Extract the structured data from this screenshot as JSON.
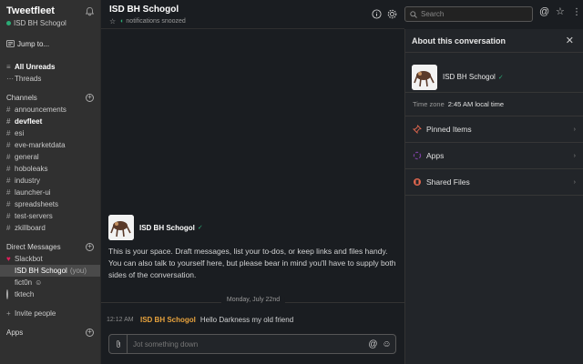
{
  "workspace": {
    "name": "Tweetfleet",
    "user": "ISD BH Schogol"
  },
  "sidebar": {
    "jump_label": "Jump to...",
    "all_unreads": "All Unreads",
    "threads": "Threads",
    "channels_header": "Channels",
    "channels": [
      {
        "name": "announcements",
        "bold": false
      },
      {
        "name": "devfleet",
        "bold": true
      },
      {
        "name": "esi",
        "bold": false
      },
      {
        "name": "eve-marketdata",
        "bold": false
      },
      {
        "name": "general",
        "bold": false
      },
      {
        "name": "hoboleaks",
        "bold": false
      },
      {
        "name": "industry",
        "bold": false
      },
      {
        "name": "launcher-ui",
        "bold": false
      },
      {
        "name": "spreadsheets",
        "bold": false
      },
      {
        "name": "test-servers",
        "bold": false
      },
      {
        "name": "zkillboard",
        "bold": false
      }
    ],
    "dm_header": "Direct Messages",
    "dms": [
      {
        "name": "Slackbot",
        "suffix": ""
      },
      {
        "name": "ISD BH Schogol",
        "suffix": "(you)"
      },
      {
        "name": "fict0n",
        "suffix": ""
      },
      {
        "name": "tktech",
        "suffix": ""
      }
    ],
    "invite": "Invite people",
    "apps_header": "Apps"
  },
  "channel": {
    "title": "ISD BH Schogol",
    "status": "notifications snoozed"
  },
  "intro": {
    "name": "ISD BH Schogol",
    "text": "This is your space. Draft messages, list your to-dos, or keep links and files handy. You can also talk to yourself here, but please bear in mind you'll have to supply both sides of the conversation."
  },
  "divider": "Monday, July 22nd",
  "message": {
    "time": "12:12 AM",
    "author": "ISD BH Schogol",
    "text": "Hello Darkness my old friend"
  },
  "composer": {
    "placeholder": "Jot something down"
  },
  "search": {
    "placeholder": "Search"
  },
  "panel": {
    "title": "About this conversation",
    "profile_name": "ISD BH Schogol",
    "tz_key": "Time zone",
    "tz_value": "2:45 AM local time",
    "rows": [
      "Pinned Items",
      "Apps",
      "Shared Files"
    ]
  },
  "colors": {
    "presence": "#2bac76",
    "author": "#e8a33d",
    "sidebar": "#303030",
    "background": "#1a1d21"
  }
}
